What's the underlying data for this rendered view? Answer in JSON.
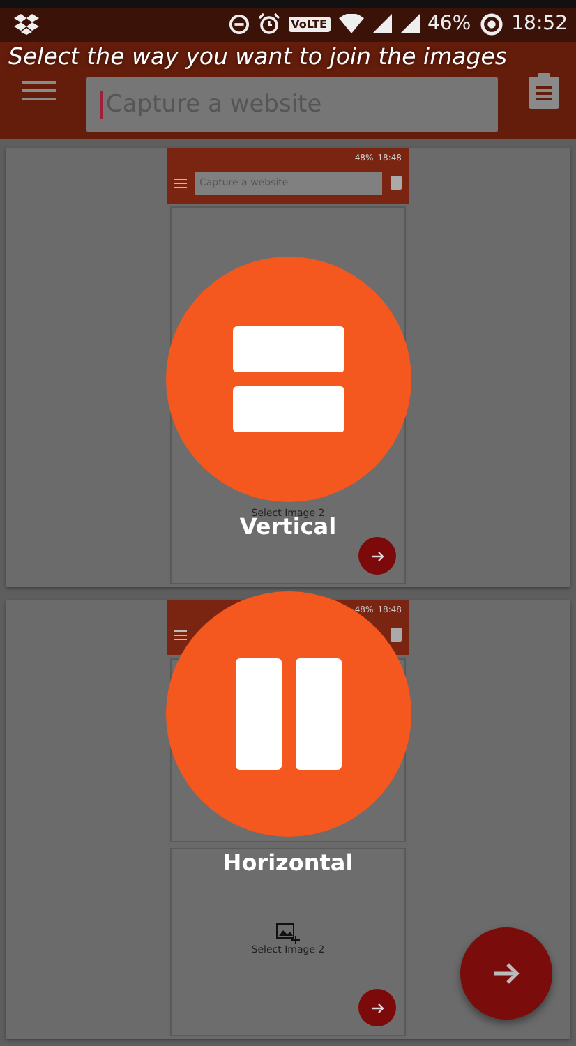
{
  "status_bar": {
    "network_badge": "VoLTE",
    "battery": "46%",
    "time": "18:52"
  },
  "app_bar": {
    "search": {
      "placeholder": "Capture a website"
    }
  },
  "hint": "Select the way you want to join the images",
  "options": [
    {
      "kind": "vertical",
      "label": "Vertical",
      "preview": {
        "battery": "48%",
        "time": "18:48",
        "search_placeholder": "Capture a website",
        "slot_label": "Select Image 2"
      }
    },
    {
      "kind": "horizontal",
      "label": "Horizontal",
      "preview": {
        "battery": "48%",
        "time": "18:48",
        "slot_label": "Select Image 2"
      }
    }
  ]
}
